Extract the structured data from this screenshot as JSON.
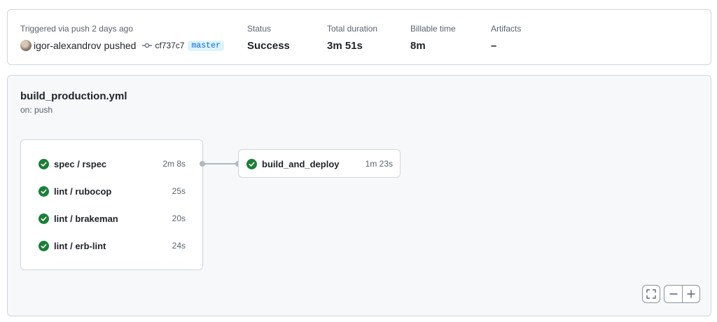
{
  "summary": {
    "trigger_label": "Triggered via push 2 days ago",
    "actor": "igor-alexandrov",
    "action": "pushed",
    "commit_sha": "cf737c7",
    "branch": "master",
    "status_label": "Status",
    "status_value": "Success",
    "duration_label": "Total duration",
    "duration_value": "3m 51s",
    "billable_label": "Billable time",
    "billable_value": "8m",
    "artifacts_label": "Artifacts",
    "artifacts_value": "–"
  },
  "workflow": {
    "file": "build_production.yml",
    "trigger": "on: push",
    "jobs": [
      {
        "name": "spec / rspec",
        "duration": "2m 8s",
        "status": "success"
      },
      {
        "name": "lint / rubocop",
        "duration": "25s",
        "status": "success"
      },
      {
        "name": "lint / brakeman",
        "duration": "20s",
        "status": "success"
      },
      {
        "name": "lint / erb-lint",
        "duration": "24s",
        "status": "success"
      }
    ],
    "deploy_job": {
      "name": "build_and_deploy",
      "duration": "1m 23s",
      "status": "success"
    }
  },
  "controls": {
    "fullscreen_icon": "fullscreen-icon",
    "zoom_out_icon": "minus-icon",
    "zoom_in_icon": "plus-icon"
  },
  "colors": {
    "success": "#1a7f37",
    "branch_text": "#0969da",
    "branch_bg": "#ddf4ff",
    "border": "#d0d7de",
    "canvas_bg": "#f6f8fa"
  }
}
